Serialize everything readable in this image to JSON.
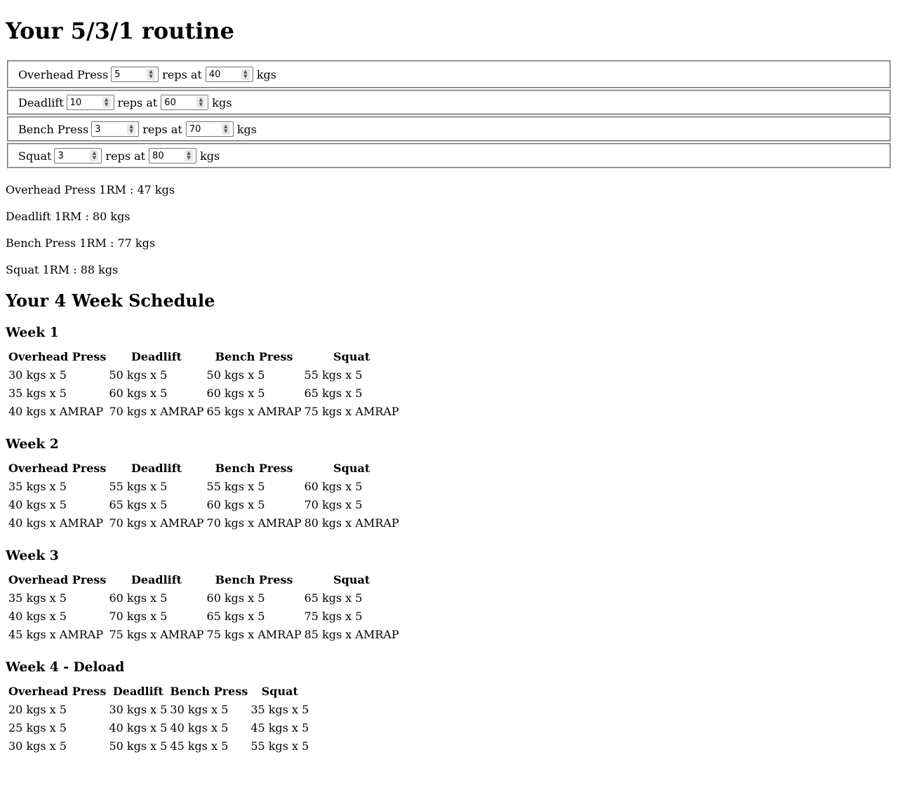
{
  "title": "Your 5/3/1 routine",
  "lifts": [
    {
      "name": "Overhead Press",
      "reps": "5",
      "weight": "40"
    },
    {
      "name": "Deadlift",
      "reps": "10",
      "weight": "60"
    },
    {
      "name": "Bench Press",
      "reps": "3",
      "weight": "70"
    },
    {
      "name": "Squat",
      "reps": "3",
      "weight": "80"
    }
  ],
  "reps_at_label": "reps at",
  "unit_label": "kgs",
  "one_rm": [
    "Overhead Press 1RM : 47 kgs",
    "Deadlift 1RM : 80 kgs",
    "Bench Press 1RM : 77 kgs",
    "Squat 1RM : 88 kgs"
  ],
  "schedule_title": "Your 4 Week Schedule",
  "weeks": [
    {
      "title": "Week 1",
      "headers": [
        "Overhead Press",
        "Deadlift",
        "Bench Press",
        "Squat"
      ],
      "rows": [
        [
          "30 kgs x 5",
          "50 kgs x 5",
          "50 kgs x 5",
          "55 kgs x 5"
        ],
        [
          "35 kgs x 5",
          "60 kgs x 5",
          "60 kgs x 5",
          "65 kgs x 5"
        ],
        [
          "40 kgs x AMRAP",
          "70 kgs x AMRAP",
          "65 kgs x AMRAP",
          "75 kgs x AMRAP"
        ]
      ]
    },
    {
      "title": "Week 2",
      "headers": [
        "Overhead Press",
        "Deadlift",
        "Bench Press",
        "Squat"
      ],
      "rows": [
        [
          "35 kgs x 5",
          "55 kgs x 5",
          "55 kgs x 5",
          "60 kgs x 5"
        ],
        [
          "40 kgs x 5",
          "65 kgs x 5",
          "60 kgs x 5",
          "70 kgs x 5"
        ],
        [
          "40 kgs x AMRAP",
          "70 kgs x AMRAP",
          "70 kgs x AMRAP",
          "80 kgs x AMRAP"
        ]
      ]
    },
    {
      "title": "Week 3",
      "headers": [
        "Overhead Press",
        "Deadlift",
        "Bench Press",
        "Squat"
      ],
      "rows": [
        [
          "35 kgs x 5",
          "60 kgs x 5",
          "60 kgs x 5",
          "65 kgs x 5"
        ],
        [
          "40 kgs x 5",
          "70 kgs x 5",
          "65 kgs x 5",
          "75 kgs x 5"
        ],
        [
          "45 kgs x AMRAP",
          "75 kgs x AMRAP",
          "75 kgs x AMRAP",
          "85 kgs x AMRAP"
        ]
      ]
    },
    {
      "title": "Week 4 - Deload",
      "headers": [
        "Overhead Press",
        "Deadlift",
        "Bench Press",
        "Squat"
      ],
      "rows": [
        [
          "20 kgs x 5",
          "30 kgs x 5",
          "30 kgs x 5",
          "35 kgs x 5"
        ],
        [
          "25 kgs x 5",
          "40 kgs x 5",
          "40 kgs x 5",
          "45 kgs x 5"
        ],
        [
          "30 kgs x 5",
          "50 kgs x 5",
          "45 kgs x 5",
          "55 kgs x 5"
        ]
      ]
    }
  ]
}
